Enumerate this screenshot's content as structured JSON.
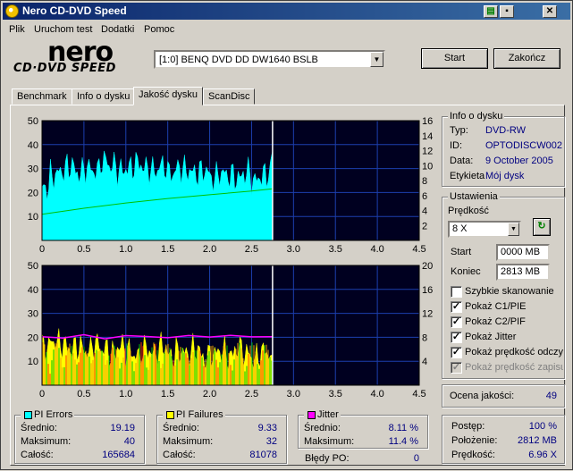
{
  "window": {
    "title": "Nero CD-DVD Speed",
    "logo_text": "nero",
    "logo_sub": "CD·DVD SPEED"
  },
  "menu": [
    "Plik",
    "Uruchom test",
    "Dodatki",
    "Pomoc"
  ],
  "drive": {
    "selected": "[1:0]   BENQ DVD DD DW1640 BSLB"
  },
  "buttons": {
    "start": "Start",
    "stop": "Zakończ"
  },
  "tabs": [
    "Benchmark",
    "Info o dysku",
    "Jakość dysku",
    "ScanDisc"
  ],
  "active_tab": "Jakość dysku",
  "disc_info": {
    "title": "Info o dysku",
    "rows": [
      {
        "label": "Typ:",
        "value": "DVD-RW"
      },
      {
        "label": "ID:",
        "value": "OPTODISCW002"
      },
      {
        "label": "Data:",
        "value": "9 October 2005"
      },
      {
        "label": "Etykieta",
        "value": "Mój dysk"
      }
    ]
  },
  "settings": {
    "title": "Ustawienia",
    "speed_label": "Prędkość",
    "speed_value": "8 X",
    "start_label": "Start",
    "start_value": "0000 MB",
    "end_label": "Koniec",
    "end_value": "2813 MB",
    "checkboxes": [
      {
        "label": "Szybkie skanowanie",
        "checked": false,
        "disabled": false
      },
      {
        "label": "Pokaż C1/PIE",
        "checked": true,
        "disabled": false
      },
      {
        "label": "Pokaż C2/PIF",
        "checked": true,
        "disabled": false
      },
      {
        "label": "Pokaż Jitter",
        "checked": true,
        "disabled": false
      },
      {
        "label": "Pokaż prędkość odczy",
        "checked": true,
        "disabled": false
      },
      {
        "label": "Pokaż prędkość zapisu",
        "checked": true,
        "disabled": true
      }
    ]
  },
  "quality": {
    "label": "Ocena jakości:",
    "value": "49"
  },
  "progress": {
    "rows": [
      {
        "label": "Postęp:",
        "value": "100 %"
      },
      {
        "label": "Położenie:",
        "value": "2812 MB"
      },
      {
        "label": "Prędkość:",
        "value": "6.96 X"
      }
    ]
  },
  "stats": {
    "pi_errors": {
      "title": "PI Errors",
      "color": "#00ffff",
      "rows": [
        {
          "label": "Średnio:",
          "value": "19.19"
        },
        {
          "label": "Maksimum:",
          "value": "40"
        },
        {
          "label": "Całość:",
          "value": "165684"
        }
      ]
    },
    "pi_failures": {
      "title": "PI Failures",
      "color": "#ffff00",
      "rows": [
        {
          "label": "Średnio:",
          "value": "9.33"
        },
        {
          "label": "Maksimum:",
          "value": "32"
        },
        {
          "label": "Całość:",
          "value": "81078"
        }
      ]
    },
    "jitter": {
      "title": "Jitter",
      "color": "#ff00ff",
      "rows": [
        {
          "label": "Średnio:",
          "value": "8.11 %"
        },
        {
          "label": "Maksimum:",
          "value": "11.4 %"
        }
      ],
      "po_label": "Błędy PO:",
      "po_value": "0"
    }
  },
  "chart_data": [
    {
      "type": "area",
      "name": "PI Errors",
      "x_ticks": [
        "0",
        "0.5",
        "1.0",
        "1.5",
        "2.0",
        "2.5",
        "3.0",
        "3.5",
        "4.0",
        "4.5"
      ],
      "y_left_ticks": [
        "50",
        "40",
        "30",
        "20",
        "10"
      ],
      "y_right_ticks": [
        "16",
        "14",
        "12",
        "10",
        "8",
        "6",
        "4",
        "2"
      ],
      "xlim": [
        0,
        4.5
      ],
      "ylim_left": [
        0,
        50
      ],
      "ylim_right": [
        0,
        16
      ],
      "scan_end": 2.75,
      "series": [
        {
          "color": "#00ffff",
          "x": [
            0,
            0.1,
            0.2,
            0.3,
            0.4,
            0.5,
            0.6,
            0.7,
            0.8,
            0.9,
            1.0,
            1.1,
            1.2,
            1.3,
            1.4,
            1.5,
            1.6,
            1.7,
            1.8,
            1.9,
            2.0,
            2.1,
            2.2,
            2.3,
            2.4,
            2.5,
            2.6,
            2.7,
            2.75
          ],
          "values": [
            22,
            27,
            29,
            31,
            28,
            30,
            29,
            33,
            31,
            29,
            30,
            32,
            30,
            29,
            31,
            28,
            30,
            29,
            28,
            29,
            26,
            28,
            27,
            26,
            28,
            25,
            27,
            29,
            31
          ]
        },
        {
          "color": "#00c000",
          "x": [
            0,
            0.5,
            1.0,
            1.5,
            2.0,
            2.5,
            2.75
          ],
          "values": [
            3.5,
            4.3,
            5.0,
            5.6,
            6.1,
            6.6,
            6.9
          ]
        }
      ]
    },
    {
      "type": "area",
      "name": "PI Failures / Jitter",
      "x_ticks": [
        "0",
        "0.5",
        "1.0",
        "1.5",
        "2.0",
        "2.5",
        "3.0",
        "3.5",
        "4.0",
        "4.5"
      ],
      "y_left_ticks": [
        "50",
        "40",
        "30",
        "20",
        "10"
      ],
      "y_right_ticks": [
        "20",
        "16",
        "12",
        "8",
        "4"
      ],
      "xlim": [
        0,
        4.5
      ],
      "ylim_left": [
        0,
        50
      ],
      "ylim_right": [
        0,
        20
      ],
      "scan_end": 2.75,
      "series": [
        {
          "color": "#ffff00",
          "x": [
            0,
            0.1,
            0.2,
            0.3,
            0.4,
            0.5,
            0.6,
            0.7,
            0.8,
            0.9,
            1.0,
            1.1,
            1.2,
            1.3,
            1.4,
            1.5,
            1.6,
            1.7,
            1.8,
            1.9,
            2.0,
            2.1,
            2.2,
            2.3,
            2.4,
            2.5,
            2.6,
            2.7,
            2.75
          ],
          "values": [
            16,
            18,
            17,
            15,
            16,
            14,
            17,
            15,
            13,
            16,
            14,
            12,
            15,
            13,
            16,
            12,
            14,
            13,
            15,
            11,
            13,
            14,
            12,
            15,
            13,
            11,
            14,
            12,
            13
          ]
        },
        {
          "color": "#ff00ff",
          "x": [
            0,
            0.25,
            0.5,
            0.75,
            1.0,
            1.25,
            1.5,
            1.75,
            2.0,
            2.25,
            2.5,
            2.75
          ],
          "values": [
            8.1,
            8.0,
            8.2,
            8.0,
            8.1,
            8.2,
            8.0,
            8.1,
            8.3,
            8.1,
            8.2,
            8.1
          ]
        }
      ]
    }
  ]
}
